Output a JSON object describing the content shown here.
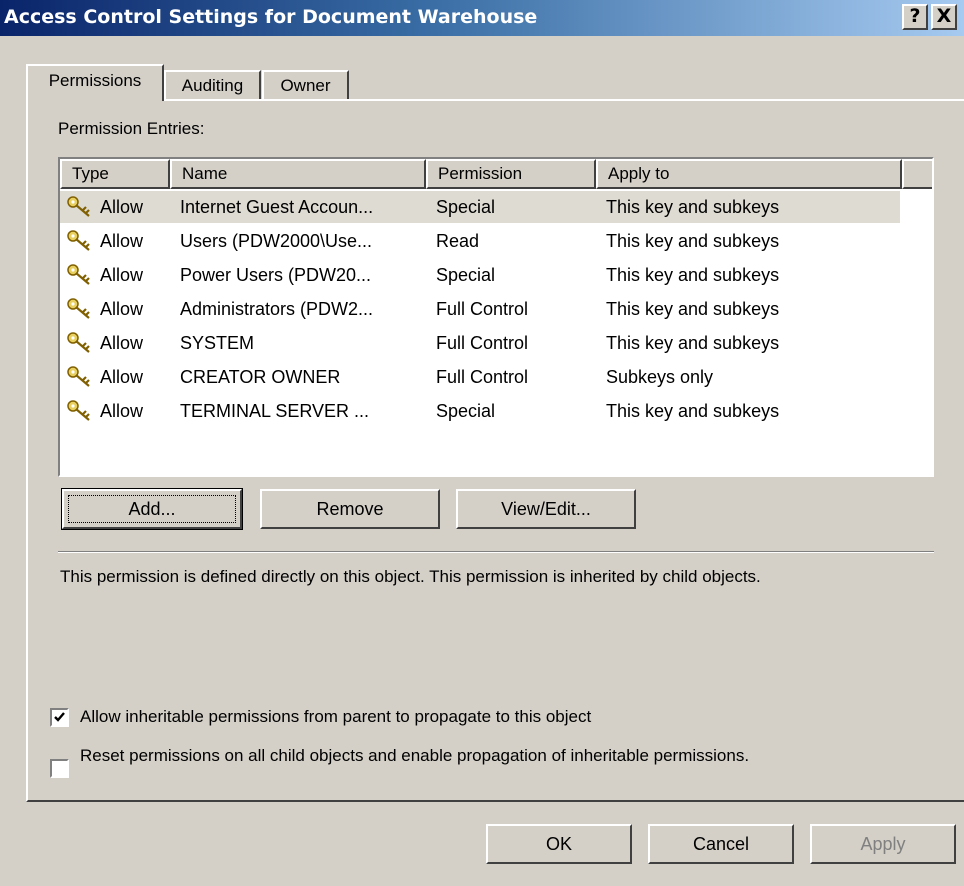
{
  "window": {
    "title": "Access Control Settings for Document Warehouse",
    "help_glyph": "?",
    "close_glyph": "X"
  },
  "tabs": [
    {
      "label": "Permissions",
      "active": true
    },
    {
      "label": "Auditing",
      "active": false
    },
    {
      "label": "Owner",
      "active": false
    }
  ],
  "permissions": {
    "entries_label": "Permission Entries:",
    "columns": [
      "Type",
      "Name",
      "Permission",
      "Apply to"
    ],
    "rows": [
      {
        "type": "Allow",
        "name": "Internet Guest Accoun...",
        "permission": "Special",
        "apply_to": "This key and subkeys",
        "selected": true
      },
      {
        "type": "Allow",
        "name": "Users (PDW2000\\Use...",
        "permission": "Read",
        "apply_to": "This key and subkeys"
      },
      {
        "type": "Allow",
        "name": "Power Users (PDW20...",
        "permission": "Special",
        "apply_to": "This key and subkeys"
      },
      {
        "type": "Allow",
        "name": "Administrators (PDW2...",
        "permission": "Full Control",
        "apply_to": "This key and subkeys"
      },
      {
        "type": "Allow",
        "name": "SYSTEM",
        "permission": "Full Control",
        "apply_to": "This key and subkeys"
      },
      {
        "type": "Allow",
        "name": "CREATOR OWNER",
        "permission": "Full Control",
        "apply_to": "Subkeys only"
      },
      {
        "type": "Allow",
        "name": "TERMINAL SERVER ...",
        "permission": "Special",
        "apply_to": "This key and subkeys"
      }
    ],
    "buttons": {
      "add": "Add...",
      "remove": "Remove",
      "view_edit": "View/Edit..."
    },
    "description": "This permission is defined directly on this object. This permission is inherited by child objects.",
    "checkboxes": [
      {
        "label": "Allow inheritable permissions from parent to propagate to this object",
        "checked": true
      },
      {
        "label": "Reset permissions on all child objects and enable propagation of inheritable permissions.",
        "checked": false
      }
    ]
  },
  "dialog_buttons": {
    "ok": "OK",
    "cancel": "Cancel",
    "apply": "Apply",
    "apply_enabled": false
  },
  "colors": {
    "titlebar_start": "#0a246a",
    "titlebar_end": "#a6caf0",
    "face": "#d4d0c8",
    "selected_row": "#dedbd3"
  },
  "icons": {
    "row_icon": "key-icon",
    "check": "checkmark-icon"
  }
}
